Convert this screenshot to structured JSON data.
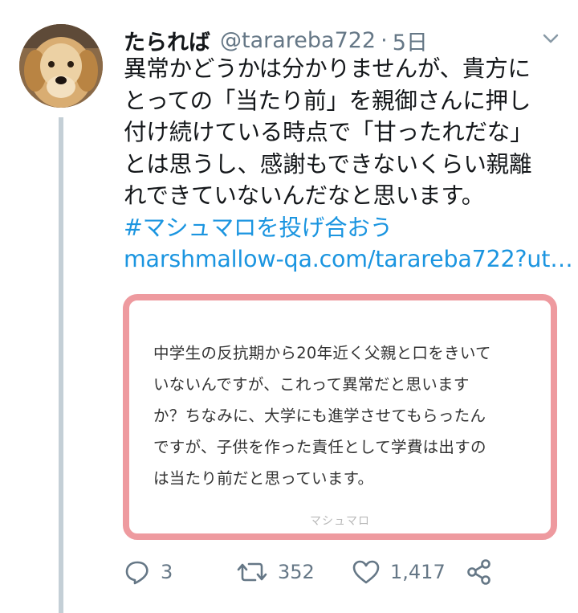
{
  "tweet": {
    "display_name": "たられば",
    "handle": "@tarareba722",
    "separator": "·",
    "time": "5日",
    "body_lines": [
      "異常かどうかは分かりませんが、貴方に",
      "とっての「当たり前」を親御さんに押し",
      "付け続けている時点で「甘ったれだな」",
      "とは思うし、感謝もできないくらい親離",
      "れできていないんだなと思います。"
    ],
    "hashtag": "#マシュマロを投げ合おう",
    "link": "marshmallow-qa.com/tarareba722?ut…"
  },
  "card": {
    "lines": [
      "中学生の反抗期から20年近く父親と口をきいて",
      "いないんですが、これって異常だと思います",
      "か？ちなみに、大学にも進学させてもらったん",
      "ですが、子供を作った責任として学費は出すの",
      "は当たり前だと思っています。"
    ],
    "footer": "マシュマロ"
  },
  "actions": {
    "reply_count": "3",
    "retweet_count": "352",
    "like_count": "1,417"
  },
  "icons": {
    "caret": "chevron-down-icon",
    "reply": "reply-icon",
    "retweet": "retweet-icon",
    "like": "heart-icon",
    "share": "share-icon"
  },
  "colors": {
    "link": "#1b95e0",
    "secondary": "#657786",
    "card_border": "#ee9a9f",
    "thread_line": "#c4cfd6"
  }
}
